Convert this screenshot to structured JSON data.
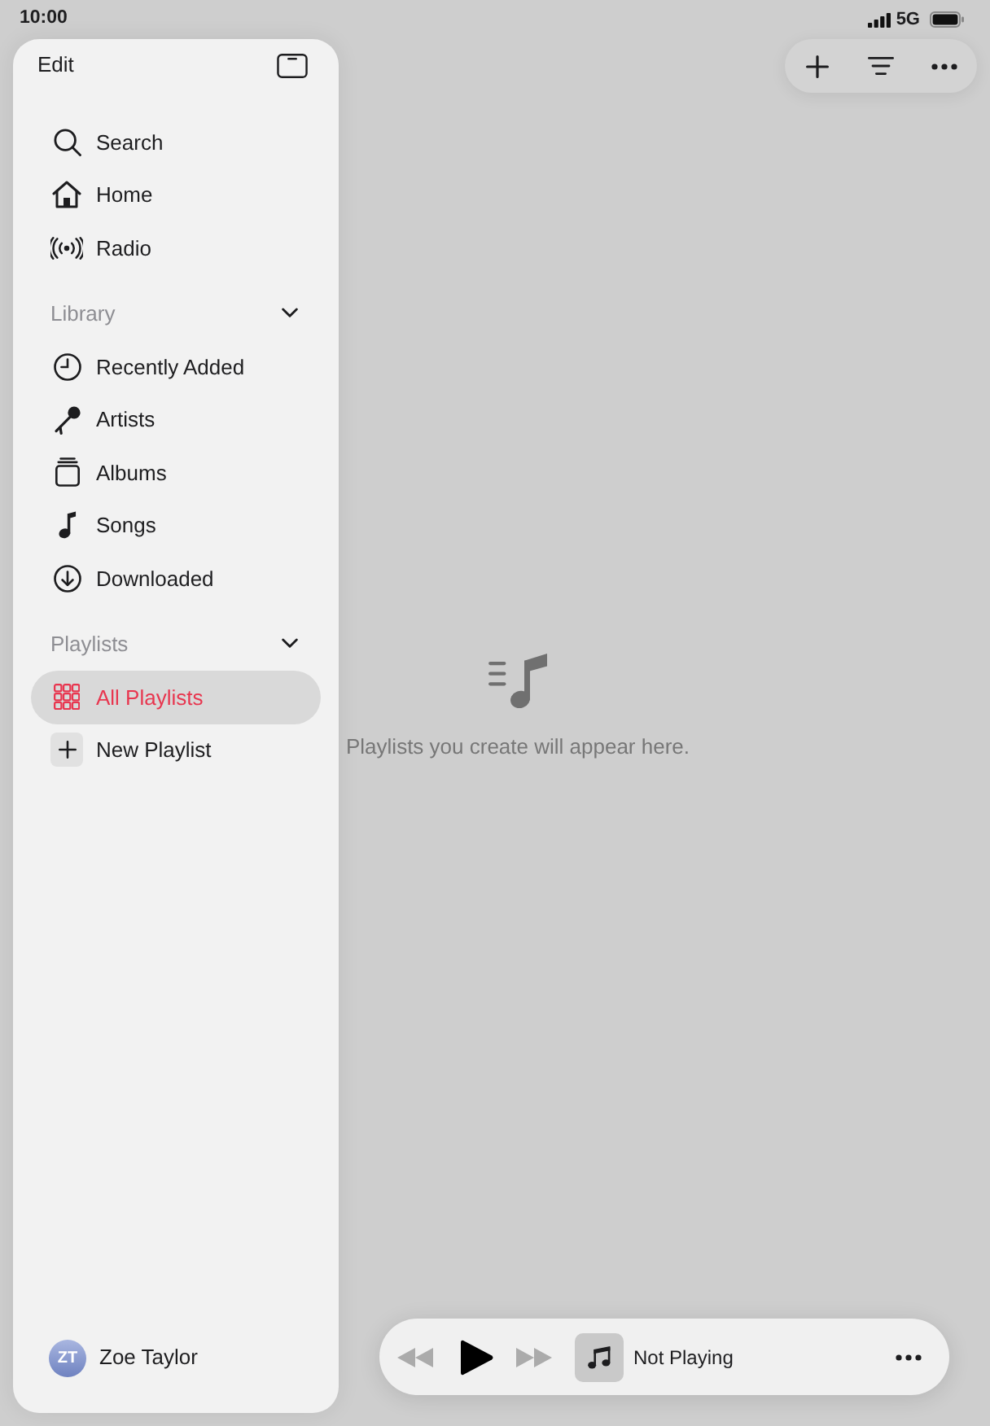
{
  "status_bar": {
    "time": "10:00",
    "network": "5G"
  },
  "sidebar": {
    "edit_label": "Edit",
    "nav_items": [
      {
        "label": "Search",
        "selected": false
      },
      {
        "label": "Home",
        "selected": false
      },
      {
        "label": "Radio",
        "selected": false
      }
    ],
    "sections": [
      {
        "title": "Library",
        "expanded": true,
        "items": [
          {
            "label": "Recently Added",
            "selected": false
          },
          {
            "label": "Artists",
            "selected": false
          },
          {
            "label": "Albums",
            "selected": false
          },
          {
            "label": "Songs",
            "selected": false
          },
          {
            "label": "Downloaded",
            "selected": false
          }
        ]
      },
      {
        "title": "Playlists",
        "expanded": true,
        "items": [
          {
            "label": "All Playlists",
            "selected": true
          },
          {
            "label": "New Playlist",
            "selected": false
          }
        ]
      }
    ],
    "user": {
      "initials": "ZT",
      "name": "Zoe Taylor"
    }
  },
  "empty_state": {
    "message": "Playlists you create will appear here."
  },
  "player": {
    "title": "Not Playing",
    "controls": [
      {
        "kind": "rewind",
        "disabled": true
      },
      {
        "kind": "play",
        "disabled": false
      },
      {
        "kind": "forward",
        "disabled": true
      }
    ]
  }
}
